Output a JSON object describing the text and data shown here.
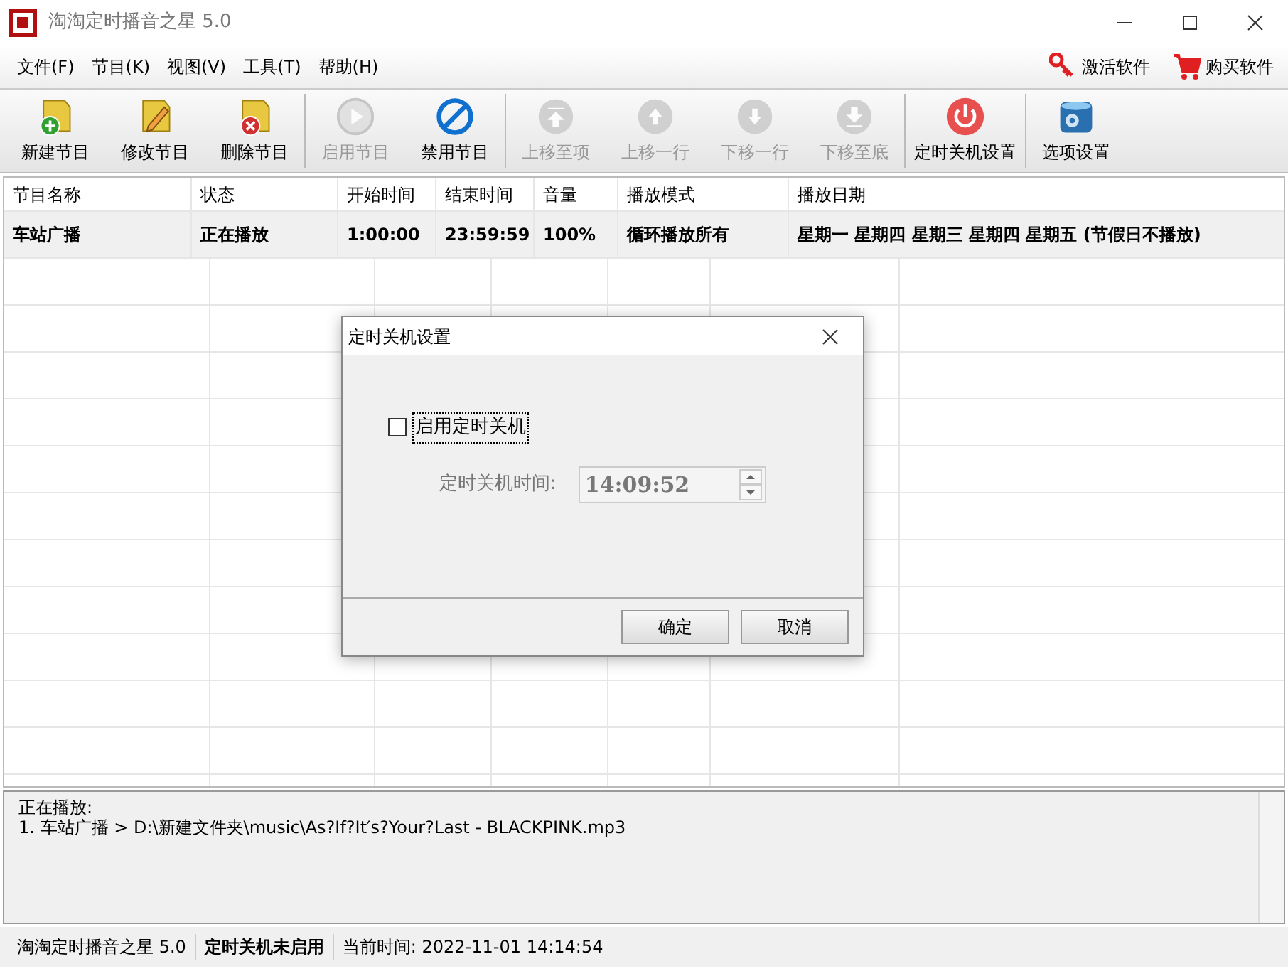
{
  "window": {
    "title": "淘淘定时播音之星 5.0"
  },
  "menu": [
    "文件(F)",
    "节目(K)",
    "视图(V)",
    "工具(T)",
    "帮助(H)"
  ],
  "menu_links": [
    {
      "label": "激活软件"
    },
    {
      "label": "购买软件"
    }
  ],
  "toolbar": [
    {
      "buttons": [
        {
          "label": "新建节目",
          "disabled": false
        },
        {
          "label": "修改节目",
          "disabled": false
        },
        {
          "label": "删除节目",
          "disabled": false
        }
      ]
    },
    {
      "buttons": [
        {
          "label": "启用节目",
          "disabled": true
        },
        {
          "label": "禁用节目",
          "disabled": false
        }
      ]
    },
    {
      "buttons": [
        {
          "label": "上移至项",
          "disabled": true
        },
        {
          "label": "上移一行",
          "disabled": true
        },
        {
          "label": "下移一行",
          "disabled": true
        },
        {
          "label": "下移至底",
          "disabled": true
        }
      ]
    },
    {
      "buttons": [
        {
          "label": "定时关机设置",
          "disabled": false
        }
      ]
    },
    {
      "buttons": [
        {
          "label": "选项设置",
          "disabled": false
        }
      ]
    }
  ],
  "table": {
    "columns": [
      "节目名称",
      "状态",
      "开始时间",
      "结束时间",
      "音量",
      "播放模式",
      "播放日期"
    ],
    "rows": [
      {
        "cells": [
          "车站广播",
          "正在播放",
          "1:00:00",
          "23:59:59",
          "100%",
          "循环播放所有",
          "星期一 星期四 星期三 星期四 星期五 (节假日不播放)"
        ],
        "selected": true
      }
    ]
  },
  "dialog": {
    "title": "定时关机设置",
    "checkbox": {
      "label": "启用定时关机",
      "checked": false
    },
    "time_label": "定时关机时间:",
    "time_value": "14:09:52",
    "time_disabled": true,
    "buttons": [
      "确定",
      "取消"
    ]
  },
  "log": {
    "lines": [
      "正在播放:",
      "1. 车站广播 > D:\\新建文件夹\\music\\As?If?It′s?Your?Last - BLACKPINK.mp3"
    ]
  },
  "status_bar": [
    {
      "text": "淘淘定时播音之星 5.0",
      "bold": false
    },
    {
      "text": "定时关机未启用",
      "bold": true
    },
    {
      "text": "当前时间:  2022-11-01 14:14:54",
      "bold": false
    }
  ]
}
